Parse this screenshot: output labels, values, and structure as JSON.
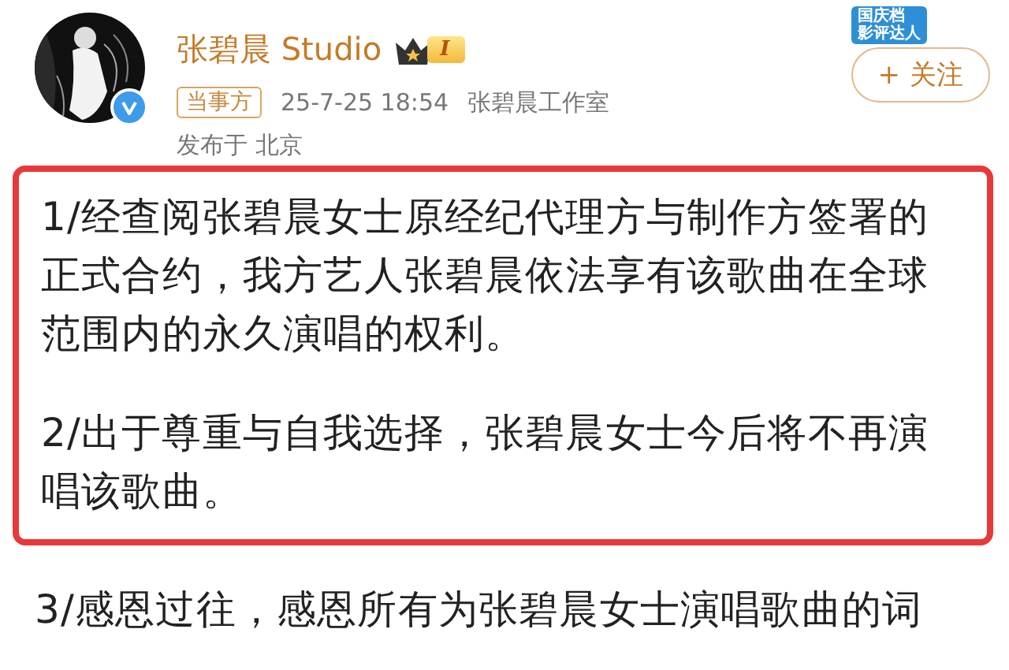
{
  "author": {
    "name": "张碧晨 Studio",
    "level": "I",
    "verified": true
  },
  "promo_badge": {
    "lines": [
      "国庆档",
      "影评达人"
    ]
  },
  "follow_button": {
    "icon": "+",
    "label": "关注"
  },
  "meta": {
    "tag": "当事方",
    "time": "25-7-25 18:54",
    "source": "张碧晨工作室",
    "location": "发布于 北京"
  },
  "highlighted": [
    {
      "lines": [
        "1/经查阅张碧晨女士原经纪代理方与制作方签署的",
        "正式合约，我方艺人张碧晨依法享有该歌曲在全球",
        "范围内的永久演唱的权利。"
      ]
    },
    {
      "lines": [
        "2/出于尊重与自我选择，张碧晨女士今后将不再演",
        "唱该歌曲。"
      ]
    }
  ],
  "body": [
    {
      "lines": [
        "3/感恩过往，感恩所有为张碧晨女士演唱歌曲的词"
      ]
    }
  ]
}
